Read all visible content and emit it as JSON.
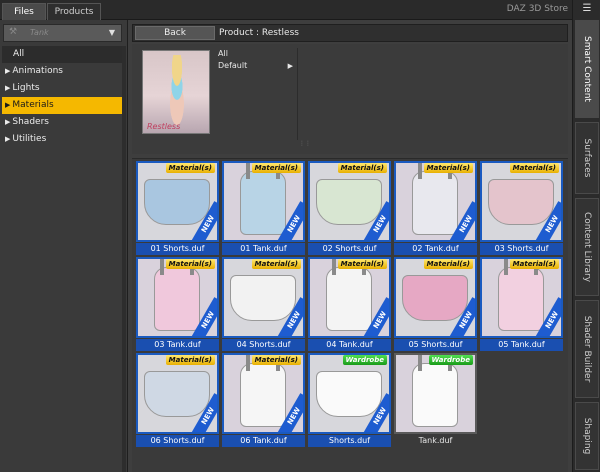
{
  "tabs": [
    {
      "label": "Files",
      "active": true
    },
    {
      "label": "Products",
      "active": false
    }
  ],
  "store_link": "DAZ 3D Store",
  "filter": {
    "value": "Tank"
  },
  "tree": {
    "all_label": "All",
    "items": [
      {
        "label": "Animations",
        "selected": false
      },
      {
        "label": "Lights",
        "selected": false
      },
      {
        "label": "Materials",
        "selected": true
      },
      {
        "label": "Shaders",
        "selected": false
      },
      {
        "label": "Utilities",
        "selected": false
      }
    ]
  },
  "nav": {
    "back_label": "Back",
    "breadcrumb": "Product : Restless"
  },
  "product": {
    "thumb_caption": "Restless",
    "variants": [
      {
        "label": "All"
      },
      {
        "label": "Default",
        "has_arrow": true
      }
    ]
  },
  "colors": {
    "selection": "#f5b800",
    "tile_border": "#1a5ac0",
    "tile_label": "#1a4fb0"
  },
  "badges": {
    "materials": "Material(s)",
    "wardrobe": "Wardrobe",
    "new": "NEW"
  },
  "tiles": [
    {
      "label": "01 Shorts.duf",
      "badge": "materials",
      "new": true,
      "kind": "shorts",
      "color": "#a9c6e0",
      "selected": true
    },
    {
      "label": "01 Tank.duf",
      "badge": "materials",
      "new": true,
      "kind": "tank",
      "color": "#b8d4e6",
      "selected": true
    },
    {
      "label": "02 Shorts.duf",
      "badge": "materials",
      "new": true,
      "kind": "shorts",
      "color": "#d8e6d2",
      "selected": true
    },
    {
      "label": "02 Tank.duf",
      "badge": "materials",
      "new": true,
      "kind": "tank",
      "color": "#e8e8ee",
      "selected": true
    },
    {
      "label": "03 Shorts.duf",
      "badge": "materials",
      "new": true,
      "kind": "shorts",
      "color": "#e4c4cc",
      "selected": true
    },
    {
      "label": "03 Tank.duf",
      "badge": "materials",
      "new": true,
      "kind": "tank",
      "color": "#f0c8dc",
      "selected": true
    },
    {
      "label": "04 Shorts.duf",
      "badge": "materials",
      "new": true,
      "kind": "shorts",
      "color": "#f2f2f2",
      "selected": true
    },
    {
      "label": "04 Tank.duf",
      "badge": "materials",
      "new": true,
      "kind": "tank",
      "color": "#f4f4f4",
      "selected": true
    },
    {
      "label": "05 Shorts.duf",
      "badge": "materials",
      "new": true,
      "kind": "shorts",
      "color": "#e6a8c4",
      "selected": true
    },
    {
      "label": "05 Tank.duf",
      "badge": "materials",
      "new": true,
      "kind": "tank",
      "color": "#f2d0e0",
      "selected": true
    },
    {
      "label": "06 Shorts.duf",
      "badge": "materials",
      "new": true,
      "kind": "shorts",
      "color": "#cfd8e4",
      "selected": true
    },
    {
      "label": "06 Tank.duf",
      "badge": "materials",
      "new": true,
      "kind": "tank",
      "color": "#f6f6f6",
      "selected": true
    },
    {
      "label": "Shorts.duf",
      "badge": "wardrobe",
      "new": true,
      "kind": "shorts",
      "color": "#fafafa",
      "selected": true
    },
    {
      "label": "Tank.duf",
      "badge": "wardrobe",
      "new": false,
      "kind": "tank",
      "color": "#fafafa",
      "selected": false
    }
  ],
  "side_tabs": [
    {
      "label": "Smart Content",
      "active": true
    },
    {
      "label": "Surfaces",
      "active": false
    },
    {
      "label": "Content Library",
      "active": false
    },
    {
      "label": "Shader Builder",
      "active": false
    },
    {
      "label": "Shaping",
      "active": false
    }
  ]
}
